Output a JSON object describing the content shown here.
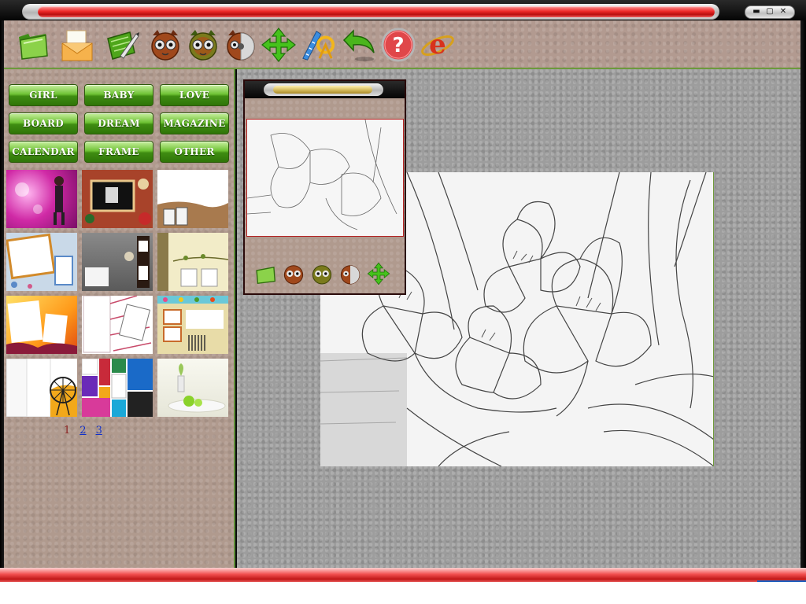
{
  "window": {
    "controls": [
      {
        "name": "minimize",
        "glyph": "▬"
      },
      {
        "name": "maximize",
        "glyph": "▢"
      },
      {
        "name": "close",
        "glyph": "✕"
      }
    ]
  },
  "toolbar": {
    "tools": [
      {
        "name": "open-folder",
        "icon": "green-folder-icon"
      },
      {
        "name": "mail",
        "icon": "envelope-icon"
      },
      {
        "name": "edit",
        "icon": "pencil-note-icon"
      },
      {
        "name": "owl-tool-1",
        "icon": "owl-face-icon"
      },
      {
        "name": "owl-tool-2",
        "icon": "owl-face-icon"
      },
      {
        "name": "owl-tool-3",
        "icon": "owl-disc-icon"
      },
      {
        "name": "move",
        "icon": "four-way-arrow-icon"
      },
      {
        "name": "measure",
        "icon": "ruler-compass-icon"
      },
      {
        "name": "undo",
        "icon": "undo-arrow-icon"
      },
      {
        "name": "help",
        "icon": "question-icon"
      },
      {
        "name": "browser",
        "icon": "internet-explorer-icon"
      }
    ]
  },
  "categories": [
    "GIRL",
    "BABY",
    "LOVE",
    "BOARD",
    "DREAM",
    "MAGAZINE",
    "CALENDAR",
    "FRAME",
    "OTHER"
  ],
  "pagination": {
    "current": "1",
    "pages": [
      "2",
      "3"
    ]
  },
  "colors": {
    "accent_red": "#e42a2a",
    "button_green": "#4e9f1c",
    "panel_brown": "#b09a8e",
    "workspace_gray": "#9d9d9d"
  }
}
